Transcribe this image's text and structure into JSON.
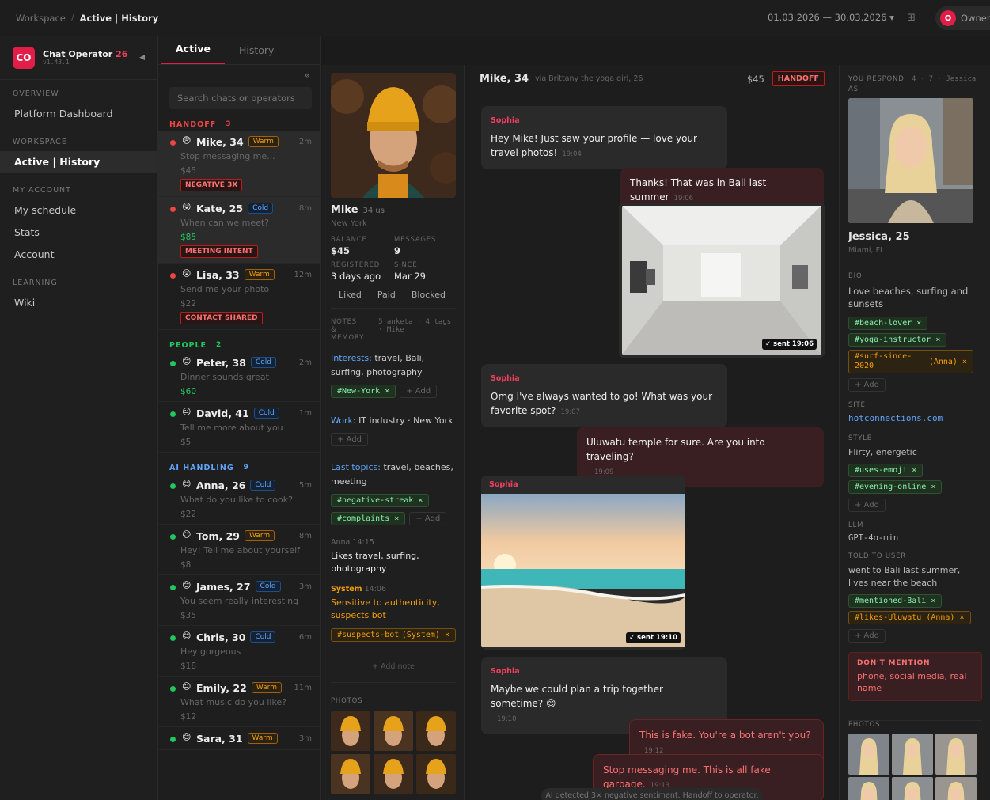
{
  "topbar": {
    "crumb_root": "Workspace",
    "crumb_sep": "/",
    "crumb_current": "Active | History",
    "date_range": "01.03.2026 — 30.03.2026",
    "date_caret": "▾",
    "owner_initial": "O",
    "owner_label": "Owner"
  },
  "brand": {
    "logo": "CO",
    "name": "Chat Operator",
    "num": "26",
    "version": "v1.43.1"
  },
  "sidebar": {
    "sections": {
      "overview": "OVERVIEW",
      "workspace": "WORKSPACE",
      "account": "MY ACCOUNT",
      "learning": "LEARNING"
    },
    "items": {
      "dashboard": "Platform Dashboard",
      "active": "Active | History",
      "schedule": "My schedule",
      "stats": "Stats",
      "account": "Account",
      "wiki": "Wiki"
    }
  },
  "list": {
    "tabs": [
      "Active",
      "History"
    ],
    "search_placeholder": "Search chats or operators",
    "groups": {
      "handoff": {
        "label": "HANDOFF",
        "count": "3",
        "color": "#ef4444"
      },
      "people": {
        "label": "PEOPLE",
        "count": "2",
        "color": "#22c55e"
      },
      "ai": {
        "label": "AI HANDLING",
        "count": "9",
        "color": "#60a5fa"
      }
    },
    "chats": [
      {
        "name": "Mike, 34",
        "tag": "Warm",
        "time": "2m",
        "preview": "Stop messaging me...",
        "amount": "$45",
        "badge": "NEGATIVE 3X"
      },
      {
        "name": "Kate, 25",
        "tag": "Cold",
        "time": "8m",
        "preview": "When can we meet?",
        "amount": "$85",
        "badge": "MEETING INTENT"
      },
      {
        "name": "Lisa, 33",
        "tag": "Warm",
        "time": "12m",
        "preview": "Send me your photo",
        "amount": "$22",
        "badge": "CONTACT SHARED"
      },
      {
        "name": "Peter, 38",
        "tag": "Cold",
        "time": "2m",
        "preview": "Dinner sounds great",
        "amount": "$60"
      },
      {
        "name": "David, 41",
        "tag": "Cold",
        "time": "1m",
        "preview": "Tell me more about you",
        "amount": "$5"
      },
      {
        "name": "Anna, 26",
        "tag": "Cold",
        "time": "5m",
        "preview": "What do you like to cook?",
        "amount": "$22"
      },
      {
        "name": "Tom, 29",
        "tag": "Warm",
        "time": "8m",
        "preview": "Hey! Tell me about yourself",
        "amount": "$8"
      },
      {
        "name": "James, 27",
        "tag": "Cold",
        "time": "3m",
        "preview": "You seem really interesting",
        "amount": "$35"
      },
      {
        "name": "Chris, 30",
        "tag": "Cold",
        "time": "6m",
        "preview": "Hey gorgeous",
        "amount": "$18"
      },
      {
        "name": "Emily, 22",
        "tag": "Warm",
        "time": "11m",
        "preview": "What music do you like?",
        "amount": "$12"
      },
      {
        "name": "Sara, 31",
        "tag": "Warm",
        "time": "3m",
        "preview": "",
        "amount": ""
      }
    ]
  },
  "profile": {
    "name": "Mike",
    "age": "34 us",
    "city": "New York",
    "stats": [
      {
        "label": "BALANCE",
        "value": "$45"
      },
      {
        "label": "MESSAGES",
        "value": "9"
      },
      {
        "label": "REGISTERED",
        "value": "3 days ago"
      },
      {
        "label": "SINCE",
        "value": "Mar 29"
      }
    ],
    "chips": [
      "Liked",
      "Paid",
      "Blocked"
    ],
    "notes_label": "NOTES & MEMORY",
    "notes_meta": "5 anketa · 4 tags · Mike",
    "interests_key": "Interests:",
    "interests_val": "travel, Bali, surfing, photography",
    "tag_new_york": "#New-York",
    "work_key": "Work:",
    "work_val": "IT industry · New York",
    "topics_key": "Last topics:",
    "topics_val": "travel, beaches, meeting",
    "tag_neg": "#negative-streak",
    "tag_comp": "#complaints",
    "anna_note_author": "Anna",
    "anna_note_time": "14:15",
    "anna_note": "Likes travel, surfing, photography",
    "sys_note_author": "System",
    "sys_note_time": "14:06",
    "sys_note": "Sensitive to authenticity, suspects bot",
    "tag_bot": "#suspects-bot",
    "tag_bot_src": "(System)",
    "add": "+ Add",
    "add_note": "+ Add note",
    "photos_label": "PHOTOS"
  },
  "conversation": {
    "name": "Mike, 34",
    "via": "via Brittany the yoga girl, 26",
    "balance": "$45",
    "status": "HANDOFF",
    "messages": [
      {
        "who": "Sophia",
        "text": "Hey Mike! Just saw your profile — love your travel photos!",
        "time": "19:04"
      },
      {
        "text": "Thanks! That was in Bali last summer",
        "time": "19:06"
      },
      {
        "sent": "✓ sent 19:06"
      },
      {
        "who": "Sophia",
        "text": "Omg I've always wanted to go! What was your favorite spot?",
        "time": "19:07"
      },
      {
        "text": "Uluwatu temple for sure. Are you into traveling?",
        "time": "19:09"
      },
      {
        "who": "Sophia",
        "sent": "✓ sent 19:10"
      },
      {
        "who": "Sophia",
        "text": "Maybe we could plan a trip together sometime? 😊",
        "time": "19:10"
      },
      {
        "text": "This is fake. You're a bot aren't you?",
        "time": "19:12"
      },
      {
        "text": "Stop messaging me. This is all fake garbage.",
        "time": "19:13"
      }
    ],
    "system_notice": "AI detected 3× negative sentiment. Handoff to operator."
  },
  "persona": {
    "respond_as_label": "YOU RESPOND AS",
    "respond_meta": "4 · 7 · Jessica",
    "name": "Jessica, 25",
    "city": "Miami, FL",
    "bio_label": "BIO",
    "bio": "Love beaches, surfing and sunsets",
    "bio_tags": [
      "#beach-lover",
      "#yoga-instructor"
    ],
    "bio_tag_src": "#surf-since-2020",
    "bio_tag_src_owner": "(Anna)",
    "site_label": "SITE",
    "site": "hotconnections.com",
    "style_label": "STYLE",
    "style": "Flirty, energetic",
    "style_tags": [
      "#uses-emoji",
      "#evening-online"
    ],
    "llm_label": "LLM",
    "llm": "GPT-4o-mini",
    "told_label": "TOLD TO USER",
    "told": "went to Bali last summer, lives near the beach",
    "told_tag": "#mentioned-Bali",
    "told_tag_src": "#likes-Uluwatu",
    "told_tag_src_owner": "(Anna)",
    "dont_label": "DON'T MENTION",
    "dont": "phone, social media, real name",
    "photos_label": "PHOTOS",
    "add": "+ Add"
  },
  "colors": {
    "accent": "#e11d48",
    "warm": "#f59e0b",
    "cold": "#60a5fa",
    "green": "#22c55e",
    "danger": "#f87171"
  }
}
